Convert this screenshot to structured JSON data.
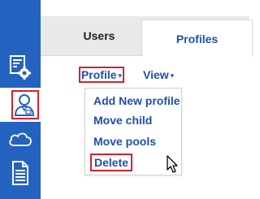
{
  "tabs": {
    "users_label": "Users",
    "profiles_label": "Profiles"
  },
  "toolbar": {
    "profile_label": "Profile",
    "view_label": "View",
    "caret": "▾"
  },
  "menu": {
    "items": [
      {
        "label": "Add New profile"
      },
      {
        "label": "Move child"
      },
      {
        "label": "Move pools"
      },
      {
        "label": "Delete"
      }
    ]
  },
  "sidebar": {
    "icons": [
      "config-icon",
      "profile-icon",
      "cloud-icon",
      "document-icon"
    ]
  },
  "colors": {
    "sidebar_blue": "#2462c0",
    "link_blue": "#1d4fae",
    "highlight_red": "#d7202e",
    "tab_gray": "#e9e9e9"
  }
}
